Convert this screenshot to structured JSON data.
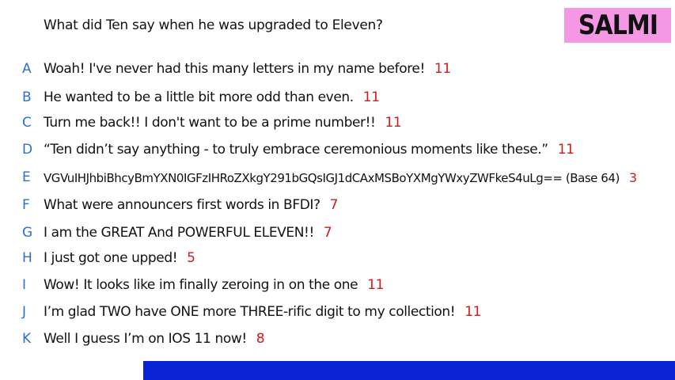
{
  "question": "What did Ten say when he was upgraded to Eleven?",
  "badge": "SALMI",
  "answers": [
    {
      "letter": "A",
      "text": "Woah! I've never had this many letters in my name before!",
      "score": "11"
    },
    {
      "letter": "B",
      "text": "He wanted to be a little bit more odd than even.",
      "score": "11"
    },
    {
      "letter": "C",
      "text": "Turn me back!! I don't want to be a prime number!!",
      "score": "11"
    },
    {
      "letter": "D",
      "text": "“Ten didn’t say anything - to truly embrace ceremonious moments like these.”",
      "score": "11"
    },
    {
      "letter": "E",
      "text": "VGVuIHJhbiBhcyBmYXN0IGFzIHRoZXkgY291bGQsIGJ1dCAxMSBoYXMgYWxyZWFkeS4uLg== (Base 64)",
      "score": "3"
    },
    {
      "letter": "F",
      "text": "What were announcers first words in BFDI?",
      "score": "7"
    },
    {
      "letter": "G",
      "text": "I am the GREAT And POWERFUL ELEVEN!!",
      "score": "7"
    },
    {
      "letter": "H",
      "text": "I just got one upped!",
      "score": "5"
    },
    {
      "letter": "I",
      "text": "Wow! It looks like im finally zeroing in on the one",
      "score": "11"
    },
    {
      "letter": "J",
      "text": "I’m glad TWO have ONE more THREE-rific digit to my collection!",
      "score": "11"
    },
    {
      "letter": "K",
      "text": "Well I guess I’m on IOS 11 now!",
      "score": "8"
    }
  ],
  "colors": {
    "letter": "#2d6fd3",
    "score": "#d21a1a",
    "badge_bg": "#f598e3",
    "bottom_bar": "#0a23d4"
  }
}
